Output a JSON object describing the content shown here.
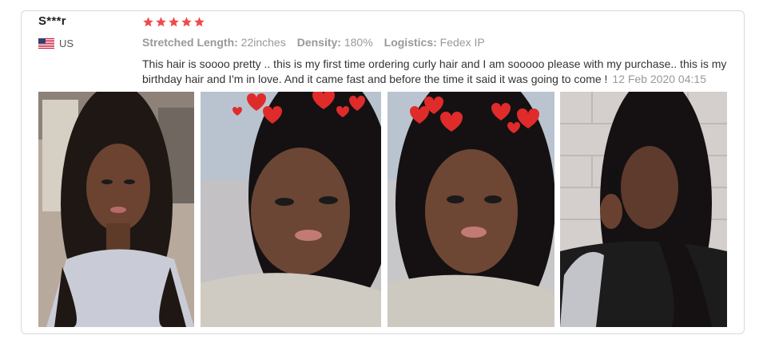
{
  "review": {
    "reviewer_name": "S***r",
    "country": "US",
    "rating": 5,
    "attributes": [
      {
        "label": "Stretched Length:",
        "value": "22inches"
      },
      {
        "label": "Density:",
        "value": "180%"
      },
      {
        "label": "Logistics:",
        "value": "Fedex IP"
      }
    ],
    "text": "This hair is soooo pretty .. this is my first time ordering curly hair and I am sooooo please with my purchase.. this is my birthday hair and I'm in love. And it came fast and before the time it said it was going to come !",
    "date": "12 Feb 2020 04:15"
  },
  "colors": {
    "star": "#f04a4a",
    "border": "#d8d8d8",
    "text": "#333333",
    "muted": "#999999"
  },
  "photos": [
    {
      "icon": "customer-photo-car"
    },
    {
      "icon": "customer-photo-hearts-filter"
    },
    {
      "icon": "customer-photo-hearts-filter"
    },
    {
      "icon": "customer-photo-phone-call"
    }
  ]
}
